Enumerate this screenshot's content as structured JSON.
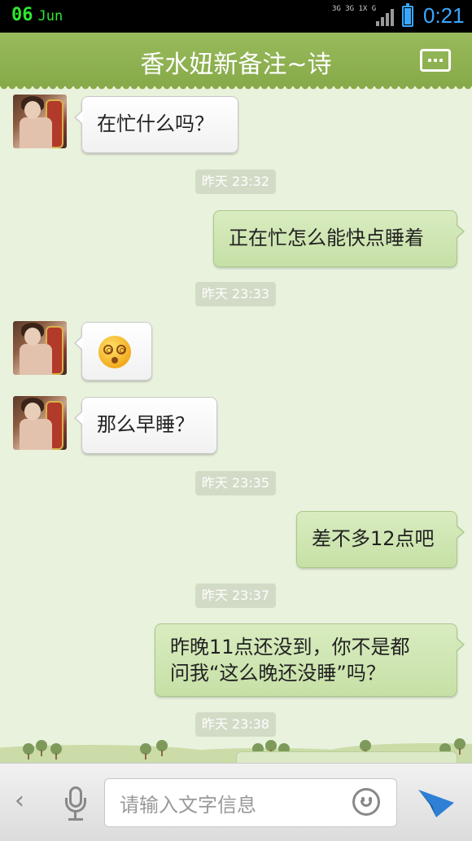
{
  "statusbar": {
    "day": "06",
    "month": "Jun",
    "network": "3G 3G 1X G",
    "time": "0:21"
  },
  "header": {
    "title": "香水妞新备注~诗"
  },
  "messages": [
    {
      "side": "in",
      "text": "在忙什么吗？"
    },
    {
      "side": "ts",
      "text": "昨天 23:32"
    },
    {
      "side": "out",
      "text": "正在忙怎么能快点睡着"
    },
    {
      "side": "ts",
      "text": "昨天 23:33"
    },
    {
      "side": "in",
      "text": "",
      "emoji": "dizzy-face-emoji"
    },
    {
      "side": "in",
      "text": "那么早睡？"
    },
    {
      "side": "ts",
      "text": "昨天 23:35"
    },
    {
      "side": "out",
      "text": "差不多12点吧"
    },
    {
      "side": "ts",
      "text": "昨天 23:37"
    },
    {
      "side": "out",
      "line1": "昨晚11点还没到，你不是都",
      "line2": "问我“这么晚还没睡”吗？"
    },
    {
      "side": "ts",
      "text": "昨天 23:38"
    }
  ],
  "input": {
    "placeholder": "请输入文字信息"
  },
  "icons": {
    "back": "chevron-left-icon",
    "mic": "microphone-icon",
    "emoji": "smiley-icon",
    "send": "send-icon"
  },
  "colors": {
    "header": "#8caf4f",
    "chat_bg": "#e9f2dd",
    "out_bubble": "#cfe6b2",
    "in_bubble": "#ffffff",
    "accent": "#3aa7ff"
  }
}
